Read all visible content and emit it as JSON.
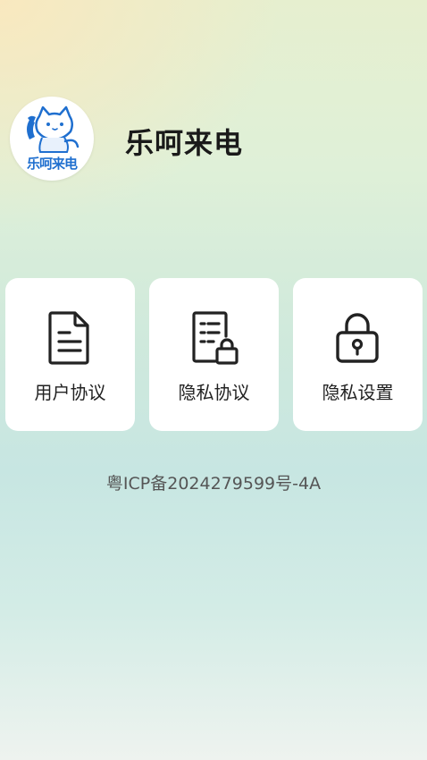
{
  "app": {
    "name": "乐呵来电",
    "logo_text": "乐呵来电",
    "brand_color": "#1f6fcf"
  },
  "menu": {
    "items": [
      {
        "label": "用户协议",
        "icon": "document-icon"
      },
      {
        "label": "隐私协议",
        "icon": "document-lock-icon"
      },
      {
        "label": "隐私设置",
        "icon": "lock-icon"
      }
    ]
  },
  "footer": {
    "icp": "粤ICP备2024279599号-4A"
  },
  "colors": {
    "card_bg": "#ffffff",
    "text_primary": "#1a1a1a",
    "text_secondary": "#555555"
  }
}
